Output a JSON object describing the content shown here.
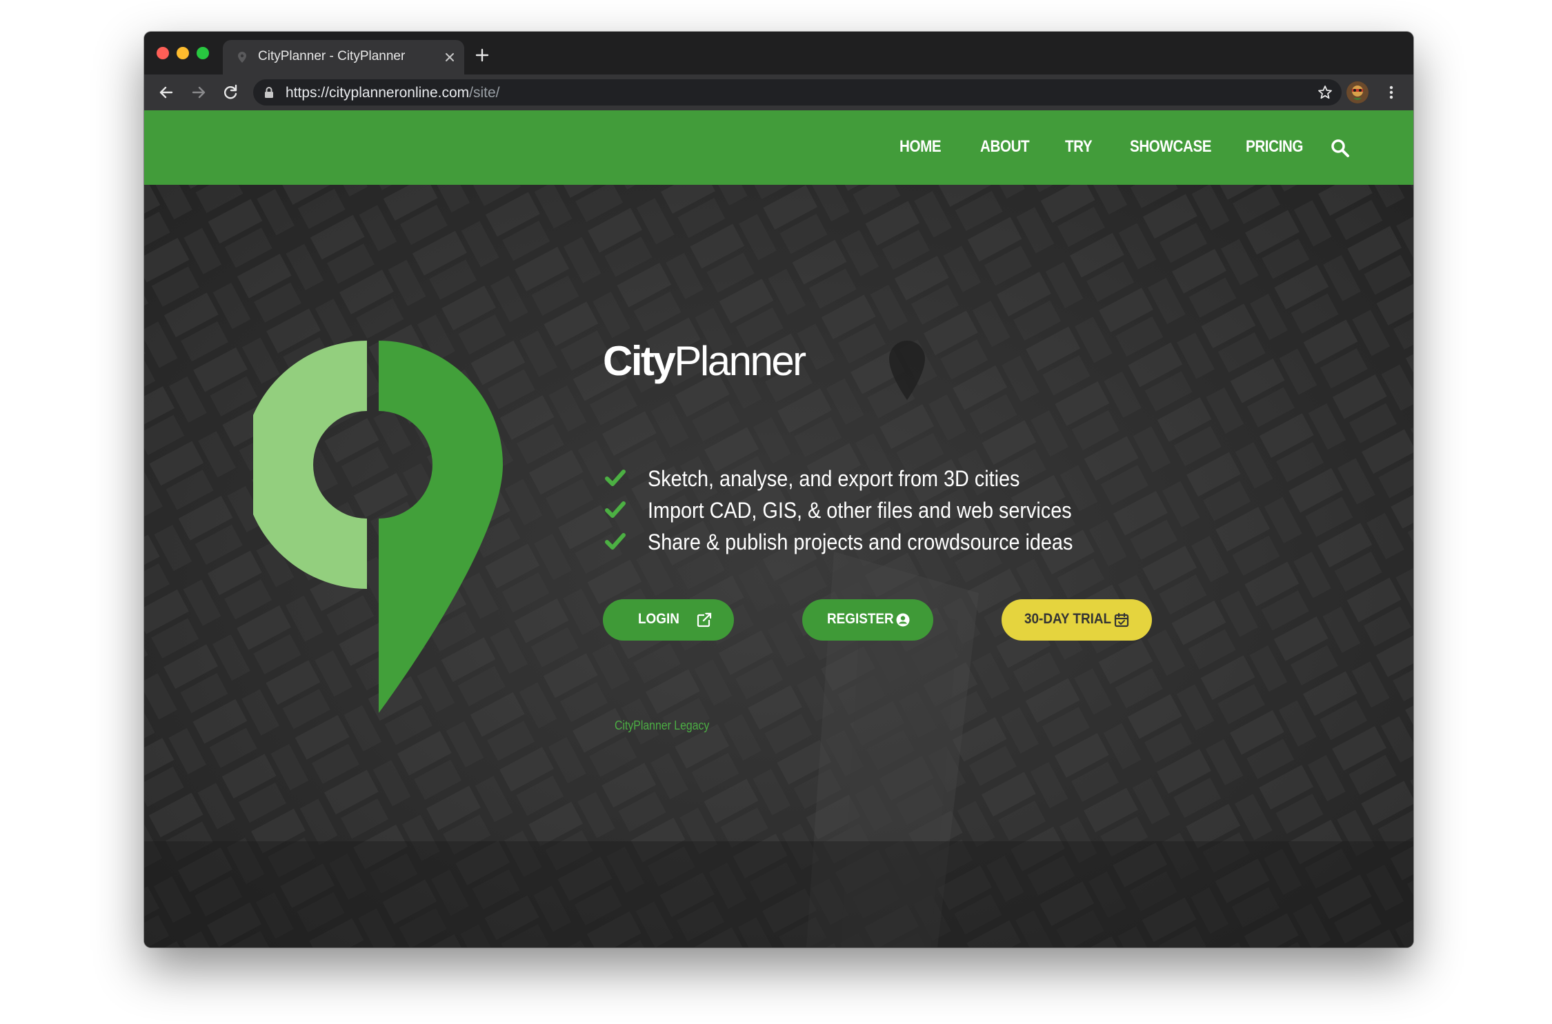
{
  "browser": {
    "tab_title": "CityPlanner - CityPlanner",
    "url_host": "https://cityplanneronline.com",
    "url_path": "/site/"
  },
  "nav": {
    "items": [
      "HOME",
      "ABOUT",
      "TRY",
      "SHOWCASE",
      "PRICING"
    ]
  },
  "hero": {
    "brand_part1": "City",
    "brand_part2": "Planner",
    "features": [
      "Sketch, analyse, and export from 3D cities",
      "Import CAD, GIS, & other files and web services",
      "Share & publish projects and crowdsource ideas"
    ],
    "buttons": {
      "login": "LOGIN",
      "register": "REGISTER",
      "trial": "30-DAY TRIAL"
    },
    "legacy_link": "CityPlanner Legacy"
  },
  "colors": {
    "nav_green": "#429c3a",
    "button_green": "#3f9a37",
    "trial_yellow": "#e5d43e",
    "logo_light": "#93cf7e",
    "logo_dark": "#42a03a"
  },
  "icons": {
    "tab": [
      "map-pin-favicon-icon",
      "close-icon",
      "plus-icon"
    ],
    "toolbar": [
      "back-arrow-icon",
      "forward-arrow-icon",
      "reload-icon",
      "lock-icon",
      "star-icon",
      "menu-dots-icon"
    ],
    "page": [
      "search-icon",
      "checkmark-icon",
      "external-link-icon",
      "user-circle-icon",
      "calendar-icon",
      "map-pin-logo-icon"
    ]
  }
}
